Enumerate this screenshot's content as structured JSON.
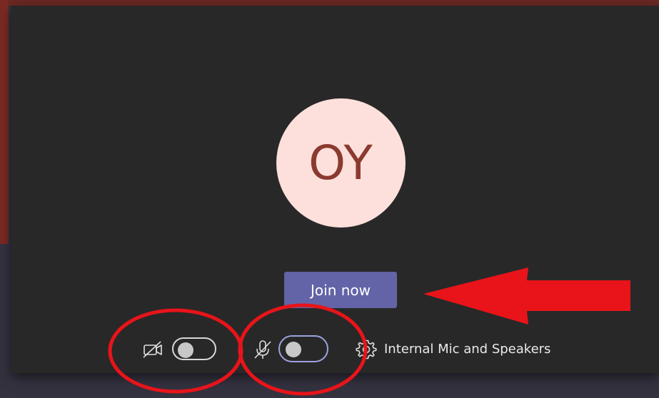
{
  "prejoin": {
    "avatar": {
      "initials": "OY",
      "bg_color": "#fde0dc",
      "text_color": "#8b3a2f"
    },
    "join_button": {
      "label": "Join now",
      "color": "#6264a7"
    },
    "camera": {
      "icon": "video-off-icon",
      "enabled": false
    },
    "microphone": {
      "icon": "mic-off-icon",
      "enabled": false,
      "focused": true,
      "focus_color": "#9ea2e0"
    },
    "device_settings": {
      "icon": "gear-icon",
      "label": "Internal Mic and Speakers"
    }
  },
  "annotations": {
    "color": "#e8141a",
    "items": [
      "arrow",
      "circle",
      "circle"
    ]
  }
}
